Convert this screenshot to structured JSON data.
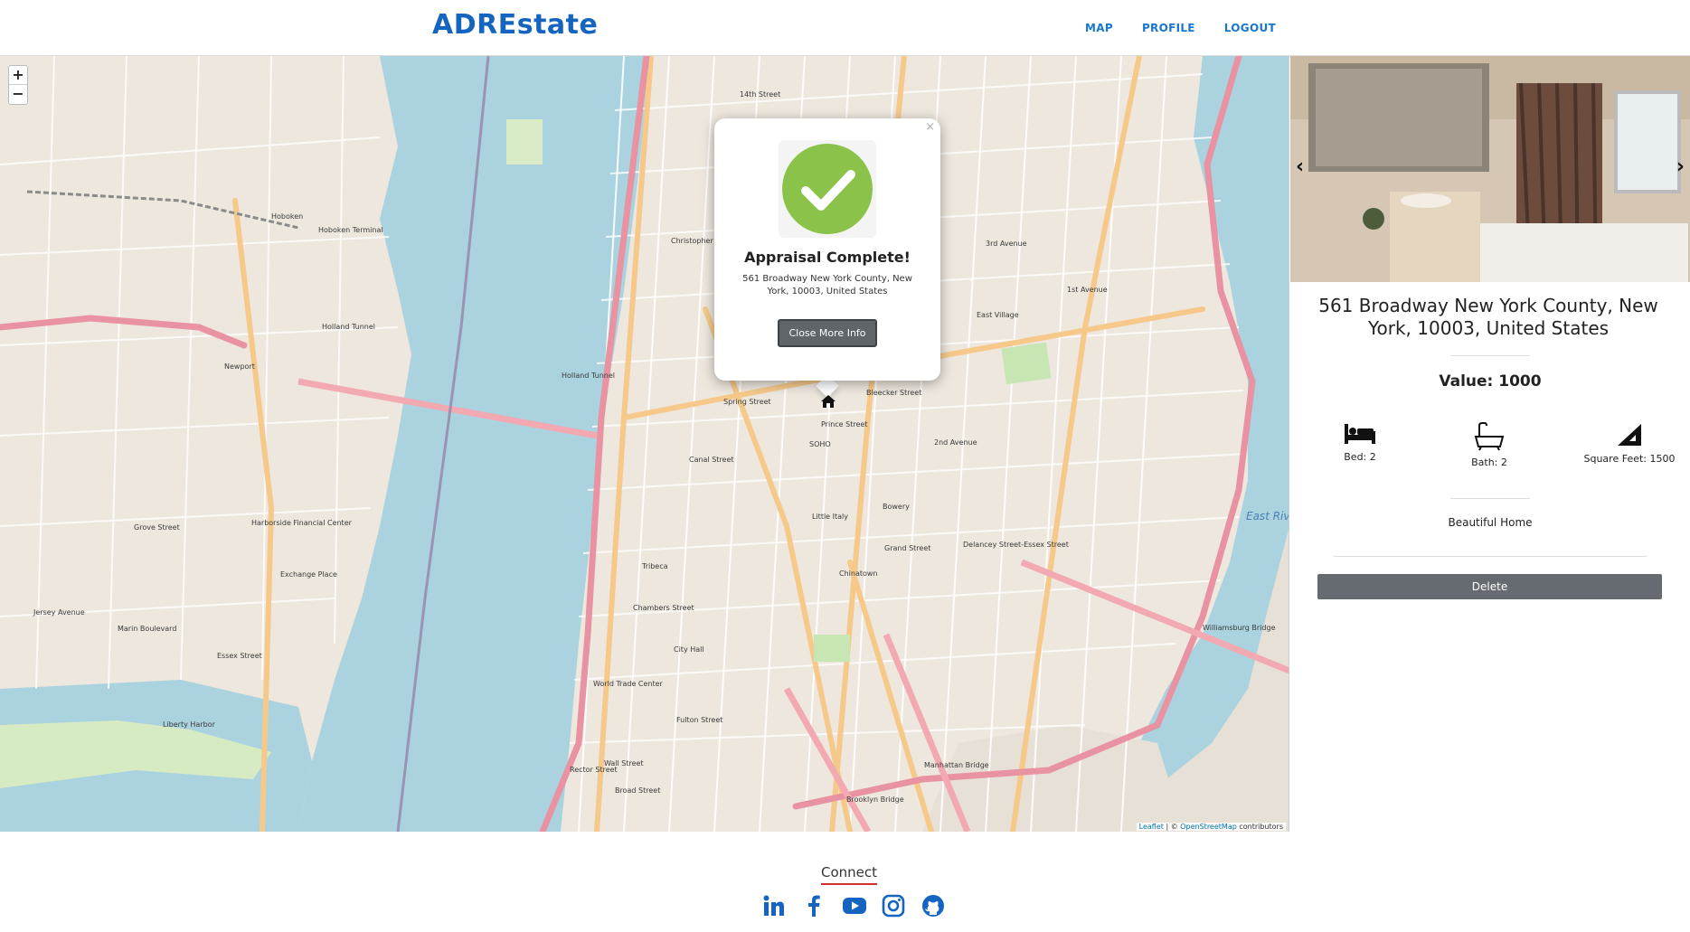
{
  "navbar": {
    "brand": "ADREstate",
    "links": [
      "MAP",
      "PROFILE",
      "LOGOUT"
    ]
  },
  "map": {
    "zoom_in": "+",
    "zoom_out": "−",
    "attribution_leaflet": "Leaflet",
    "attribution_sep": " | © ",
    "attribution_osm": "OpenStreetMap",
    "attribution_tail": " contributors",
    "labels": {
      "holland_tunnel": "Holland Tunnel",
      "holland_tunnel_2": "Holland Tunnel",
      "hoboken": "Hoboken",
      "hoboken_terminal": "Hoboken Terminal",
      "newport": "Newport",
      "harborside": "Harborside Financial Center",
      "exchange_place": "Exchange Place",
      "grove_street": "Grove Street",
      "jersey_avenue": "Jersey Avenue",
      "marin_boulevard": "Marin Boulevard",
      "essex_street": "Essex Street",
      "liberty_harbor": "Liberty Harbor",
      "christopher_street": "Christopher Street",
      "spring_street": "Spring Street",
      "prince_street": "Prince Street",
      "canal_street": "Canal Street",
      "bleecker_street": "Bleecker Street",
      "second_avenue": "2nd Avenue",
      "first_avenue": "1st Avenue",
      "third_avenue": "3rd Avenue",
      "bowery": "Bowery",
      "grand_street": "Grand Street",
      "delancey": "Delancey Street-Essex Street",
      "chambers": "Chambers Street",
      "city_hall": "City Hall",
      "fulton": "Fulton Street",
      "wall_street": "Wall Street",
      "rector": "Rector Street",
      "broad_street": "Broad Street",
      "world_trade": "World Trade Center",
      "brooklyn_bridge": "Brooklyn Bridge",
      "manhattan_bridge": "Manhattan Bridge",
      "williamsburg": "Williamsburg Bridge",
      "east_river": "East Riv",
      "fourteenth_street": "14th Street",
      "east_village": "East Village",
      "chinatown": "Chinatown",
      "tribeca": "Tribeca",
      "soho": "SOHO",
      "little_italy": "Little Italy"
    }
  },
  "popup": {
    "close": "×",
    "title": "Appraisal Complete!",
    "address": "561 Broadway New York County, New York, 10003, United States",
    "button": "Close More Info"
  },
  "property": {
    "address": "561 Broadway New York County, New York, 10003, United States",
    "value": "Value: 1000",
    "bed": "Bed: 2",
    "bath": "Bath: 2",
    "sqft": "Square Feet: 1500",
    "description": "Beautiful Home",
    "delete": "Delete",
    "prev": "‹",
    "next": "›"
  },
  "footer": {
    "connect": "Connect",
    "socials": [
      "linkedin-icon",
      "facebook-icon",
      "youtube-icon",
      "instagram-icon",
      "github-icon"
    ]
  },
  "colors": {
    "brand": "#1565c0",
    "nav": "#1976d2",
    "water": "#aad3df",
    "land": "#f2efe9",
    "success": "#8bc34a",
    "button": "#5f6569",
    "connect_underline": "#d32f2f",
    "social": "#1565c0"
  }
}
